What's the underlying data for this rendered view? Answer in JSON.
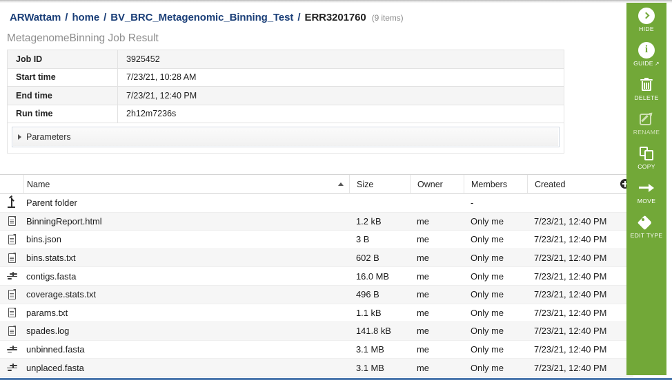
{
  "breadcrumb": {
    "items": [
      "ARWattam",
      "home",
      "BV_BRC_Metagenomic_Binning_Test"
    ],
    "current": "ERR3201760",
    "count": "(9 items)",
    "separator": "/"
  },
  "job": {
    "title": "MetagenomeBinning Job Result",
    "rows": [
      {
        "label": "Job ID",
        "value": "3925452"
      },
      {
        "label": "Start time",
        "value": "7/23/21, 10:28 AM"
      },
      {
        "label": "End time",
        "value": "7/23/21, 12:40 PM"
      },
      {
        "label": "Run time",
        "value": "2h12m7236s"
      }
    ],
    "parameters_label": "Parameters"
  },
  "file_list": {
    "columns": [
      "Name",
      "Size",
      "Owner",
      "Members",
      "Created"
    ],
    "sort_column": "Name",
    "sort_direction": "ascending",
    "parent_row": {
      "name": "Parent folder",
      "size": "",
      "owner": "",
      "members": "-",
      "created": ""
    },
    "rows": [
      {
        "icon": "document-icon",
        "name": "BinningReport.html",
        "size": "1.2 kB",
        "owner": "me",
        "members": "Only me",
        "created": "7/23/21, 12:40 PM"
      },
      {
        "icon": "document-icon",
        "name": "bins.json",
        "size": "3 B",
        "owner": "me",
        "members": "Only me",
        "created": "7/23/21, 12:40 PM"
      },
      {
        "icon": "document-icon",
        "name": "bins.stats.txt",
        "size": "602 B",
        "owner": "me",
        "members": "Only me",
        "created": "7/23/21, 12:40 PM"
      },
      {
        "icon": "contigs-icon",
        "name": "contigs.fasta",
        "size": "16.0 MB",
        "owner": "me",
        "members": "Only me",
        "created": "7/23/21, 12:40 PM"
      },
      {
        "icon": "document-icon",
        "name": "coverage.stats.txt",
        "size": "496 B",
        "owner": "me",
        "members": "Only me",
        "created": "7/23/21, 12:40 PM"
      },
      {
        "icon": "document-icon",
        "name": "params.txt",
        "size": "1.1 kB",
        "owner": "me",
        "members": "Only me",
        "created": "7/23/21, 12:40 PM"
      },
      {
        "icon": "document-icon",
        "name": "spades.log",
        "size": "141.8 kB",
        "owner": "me",
        "members": "Only me",
        "created": "7/23/21, 12:40 PM"
      },
      {
        "icon": "contigs-icon",
        "name": "unbinned.fasta",
        "size": "3.1 MB",
        "owner": "me",
        "members": "Only me",
        "created": "7/23/21, 12:40 PM"
      },
      {
        "icon": "contigs-icon",
        "name": "unplaced.fasta",
        "size": "3.1 MB",
        "owner": "me",
        "members": "Only me",
        "created": "7/23/21, 12:40 PM"
      }
    ]
  },
  "action_sidebar": {
    "accent_color": "#72a838",
    "buttons": [
      {
        "label": "HIDE",
        "icon": "chevron-right-circle-icon",
        "enabled": true,
        "external": false
      },
      {
        "label": "GUIDE",
        "icon": "info-circle-icon",
        "enabled": true,
        "external": true
      },
      {
        "label": "DELETE",
        "icon": "trash-icon",
        "enabled": true,
        "external": false
      },
      {
        "label": "RENAME",
        "icon": "pencil-edit-icon",
        "enabled": false,
        "external": false
      },
      {
        "label": "COPY",
        "icon": "copy-pages-icon",
        "enabled": true,
        "external": false
      },
      {
        "label": "MOVE",
        "icon": "arrow-right-icon",
        "enabled": true,
        "external": false
      },
      {
        "label": "EDIT TYPE",
        "icon": "tag-icon",
        "enabled": true,
        "external": false
      }
    ],
    "external_link_glyph": "↗"
  }
}
